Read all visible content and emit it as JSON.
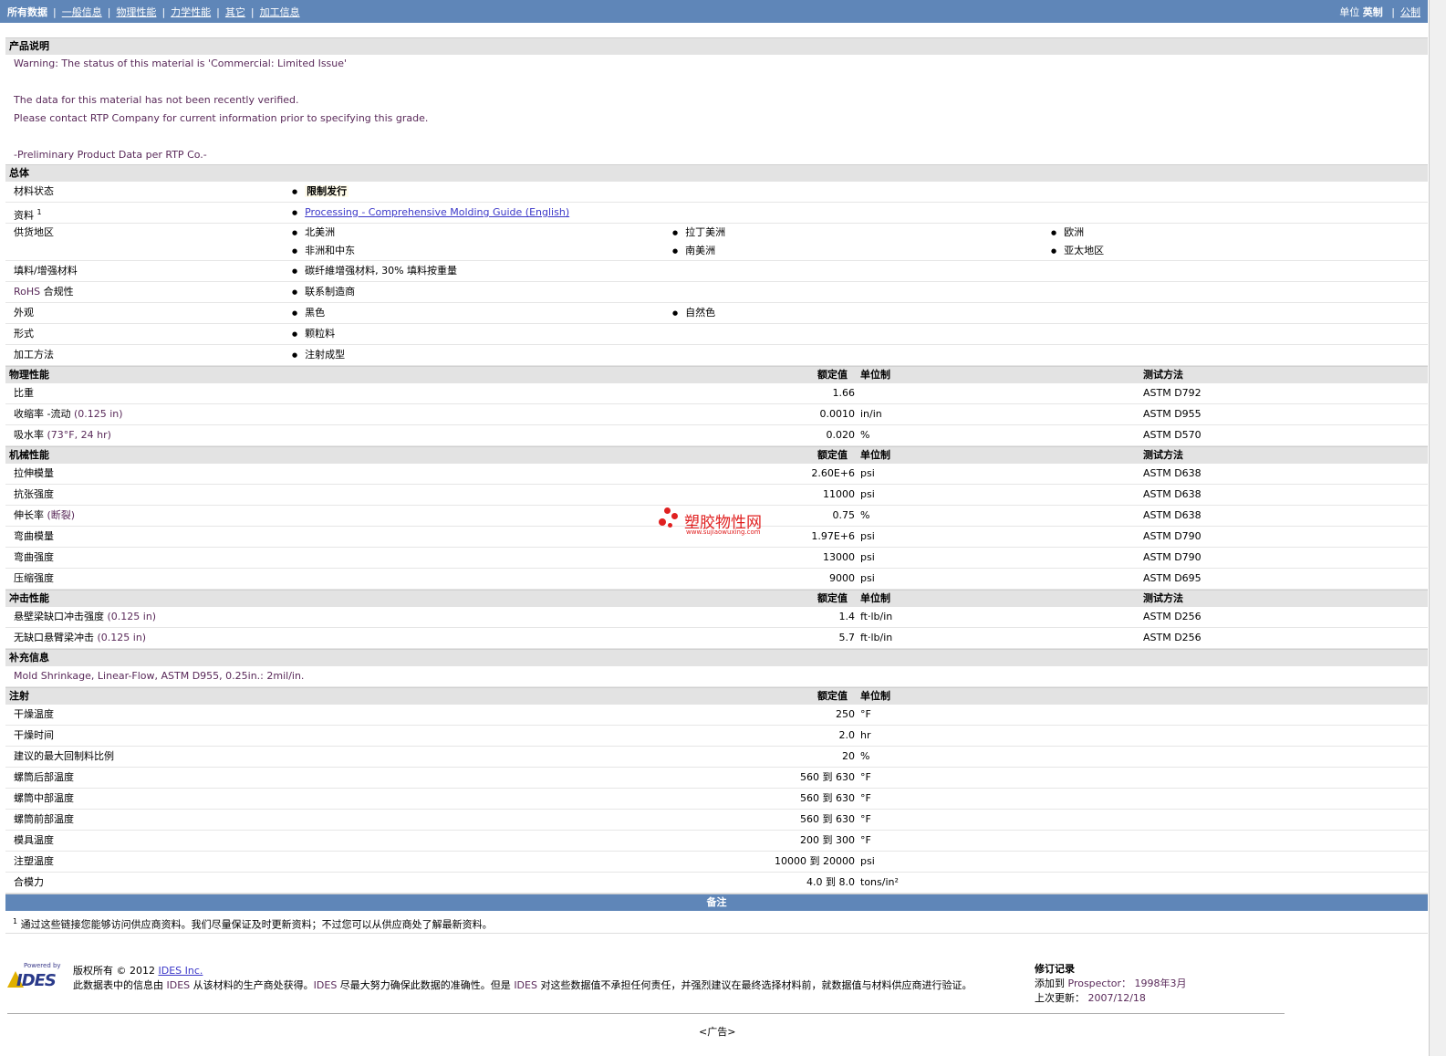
{
  "nav": {
    "items": [
      "所有数据",
      "一般信息",
      "物理性能",
      "力学性能",
      "其它",
      "加工信息"
    ],
    "units_label": "单位",
    "unit_english": "英制",
    "unit_metric": "公制"
  },
  "desc": {
    "title": "产品说明",
    "lines": [
      "Warning: The status of this material is 'Commercial: Limited Issue'",
      "",
      "The data for this material has not been recently verified.",
      "Please contact RTP Company for current information prior to specifying this grade.",
      "",
      "-Preliminary Product Data per RTP Co.-"
    ]
  },
  "general": {
    "title": "总体",
    "status_label": "材料状态",
    "status_value": "限制发行",
    "docs_label": "资料",
    "docs_sup": "1",
    "docs_link": "Processing - Comprehensive Molding Guide (English)",
    "regions_label": "供货地区",
    "regions": [
      "北美洲",
      "拉丁美洲",
      "欧洲",
      "非洲和中东",
      "南美洲",
      "亚太地区"
    ],
    "filler_label": "填料/增强材料",
    "filler_value": "碳纤維增强材料, 30% 填料按重量",
    "rohs_label_a": "RoHS",
    "rohs_label_b": " 合规性",
    "rohs_value": "联系制造商",
    "appearance_label": "外观",
    "appearance": [
      "黑色",
      "自然色"
    ],
    "form_label": "形式",
    "form_value": "颗粒料",
    "method_label": "加工方法",
    "method_value": "注射成型"
  },
  "headers": {
    "val": "额定值",
    "unit": "单位制",
    "test": "测试方法"
  },
  "physical": {
    "title": "物理性能",
    "rows": [
      {
        "label": "比重",
        "cond": "",
        "val": "1.66",
        "unit": "",
        "test": "ASTM D792"
      },
      {
        "label": "收缩率 -流动",
        "cond": "(0.125 in)",
        "val": "0.0010",
        "unit": "in/in",
        "test": "ASTM D955"
      },
      {
        "label": "吸水率",
        "cond": "(73°F, 24 hr)",
        "val": "0.020",
        "unit": "%",
        "test": "ASTM D570"
      }
    ]
  },
  "mechanical": {
    "title": "机械性能",
    "rows": [
      {
        "label": "拉伸模量",
        "cond": "",
        "val": "2.60E+6",
        "unit": "psi",
        "test": "ASTM D638"
      },
      {
        "label": "抗张强度",
        "cond": "",
        "val": "11000",
        "unit": "psi",
        "test": "ASTM D638"
      },
      {
        "label": "伸长率",
        "cond": "(断裂)",
        "val": "0.75",
        "unit": "%",
        "test": "ASTM D638"
      },
      {
        "label": "弯曲模量",
        "cond": "",
        "val": "1.97E+6",
        "unit": "psi",
        "test": "ASTM D790"
      },
      {
        "label": "弯曲强度",
        "cond": "",
        "val": "13000",
        "unit": "psi",
        "test": "ASTM D790"
      },
      {
        "label": "压缩强度",
        "cond": "",
        "val": "9000",
        "unit": "psi",
        "test": "ASTM D695"
      }
    ]
  },
  "impact": {
    "title": "冲击性能",
    "rows": [
      {
        "label": "悬壁梁缺口冲击强度",
        "cond": "(0.125 in)",
        "val": "1.4",
        "unit": "ft·lb/in",
        "test": "ASTM D256"
      },
      {
        "label": "无缺口悬臂梁冲击",
        "cond": "(0.125 in)",
        "val": "5.7",
        "unit": "ft·lb/in",
        "test": "ASTM D256"
      }
    ]
  },
  "supplement": {
    "title": "补充信息",
    "text": "Mold Shrinkage, Linear-Flow, ASTM D955, 0.25in.: 2mil/in."
  },
  "injection": {
    "title": "注射",
    "rows": [
      {
        "label": "干燥温度",
        "val": "250",
        "unit": "°F"
      },
      {
        "label": "干燥时间",
        "val": "2.0",
        "unit": "hr"
      },
      {
        "label": "建议的最大回制料比例",
        "val": "20",
        "unit": "%"
      },
      {
        "label": "螺筒后部温度",
        "val": "560 到  630",
        "unit": "°F"
      },
      {
        "label": "螺筒中部温度",
        "val": "560 到  630",
        "unit": "°F"
      },
      {
        "label": "螺筒前部温度",
        "val": "560 到  630",
        "unit": "°F"
      },
      {
        "label": "模具温度",
        "val": "200 到  300",
        "unit": "°F"
      },
      {
        "label": "注塑温度",
        "val": "10000 到  20000",
        "unit": "psi"
      },
      {
        "label": "合模力",
        "val": "4.0 到  8.0",
        "unit": "tons/in²"
      }
    ]
  },
  "notes": {
    "title": "备注",
    "sup": "1",
    "text": "通过这些链接您能够访问供应商资料。我们尽量保证及时更新资料；不过您可以从供应商处了解最新资料。"
  },
  "footer": {
    "powered_by": "Powered by",
    "logo_name": "IDES",
    "copyright_prefix": "版权所有 © 2012 ",
    "copyright_link": "IDES Inc.",
    "disclaimer_a": "此数据表中的信息由 ",
    "disclaimer_ides1": "IDES",
    "disclaimer_b": " 从该材料的生产商处获得。",
    "disclaimer_ides2": "IDES",
    "disclaimer_c": " 尽最大努力确保此数据的准确性。但是 ",
    "disclaimer_ides3": "IDES",
    "disclaimer_d": " 对这些数据值不承担任何责任，并强烈建议在最终选择材料前，就数据值与材料供应商进行验证。",
    "rev_title": "修订记录",
    "added_label": "添加到 ",
    "added_where": "Prospector",
    "added_date": "： 1998年3月",
    "updated_label": "上次更新：",
    "updated_date": "2007/12/18",
    "ad": "<广告>"
  },
  "watermark": {
    "text": "塑胶物性网",
    "url": "www.sujiaowuxing.com"
  }
}
